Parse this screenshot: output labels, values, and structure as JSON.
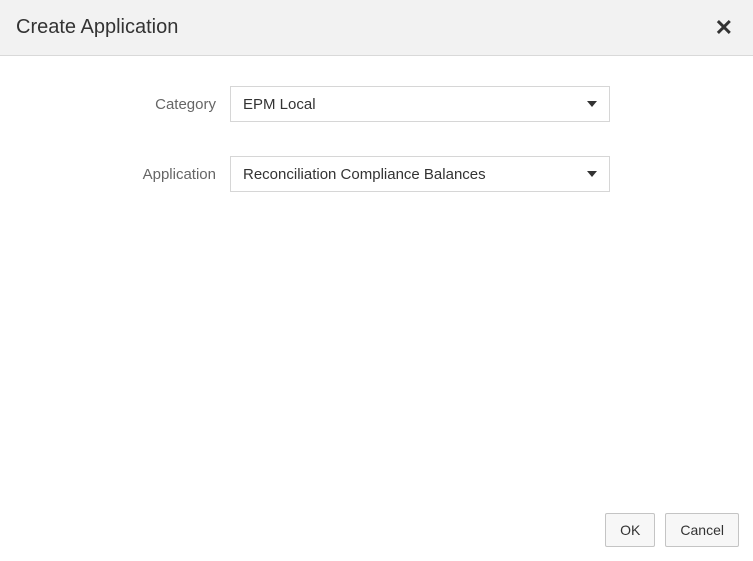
{
  "dialog": {
    "title": "Create Application"
  },
  "form": {
    "category": {
      "label": "Category",
      "value": "EPM Local"
    },
    "application": {
      "label": "Application",
      "value": "Reconciliation Compliance Balances"
    }
  },
  "footer": {
    "ok": "OK",
    "cancel": "Cancel"
  }
}
